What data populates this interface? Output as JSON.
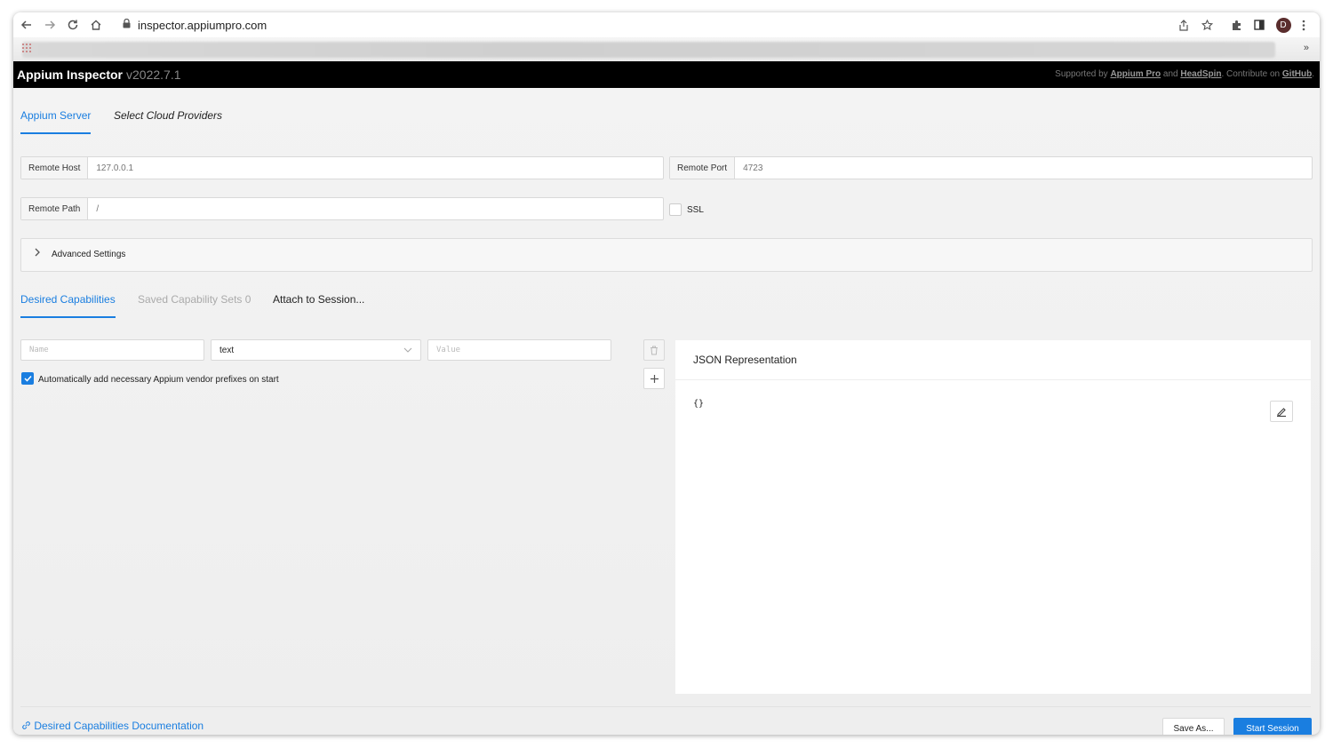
{
  "browser": {
    "url": "inspector.appiumpro.com",
    "profile_initial": "D",
    "bookmarks_more": "»"
  },
  "header": {
    "title": "Appium Inspector",
    "version": "v2022.7.1",
    "support_prefix": "Supported by",
    "link_appium_pro": "Appium Pro",
    "and": "and",
    "link_headspin": "HeadSpin",
    "contribute": ". Contribute on",
    "link_github": "GitHub",
    "period": "."
  },
  "server_tabs": [
    {
      "label": "Appium Server",
      "active": true
    },
    {
      "label": "Select Cloud Providers",
      "active": false
    }
  ],
  "server": {
    "remote_host_label": "Remote Host",
    "remote_host_placeholder": "127.0.0.1",
    "remote_port_label": "Remote Port",
    "remote_port_placeholder": "4723",
    "remote_path_label": "Remote Path",
    "remote_path_placeholder": "/",
    "ssl_label": "SSL",
    "ssl_checked": false
  },
  "advanced": {
    "label": "Advanced Settings",
    "arrow": ">"
  },
  "cap_tabs": [
    {
      "label": "Desired Capabilities",
      "active": true
    },
    {
      "label": "Saved Capability Sets 0",
      "active": false
    },
    {
      "label": "Attach to Session...",
      "active": false
    }
  ],
  "capability_row": {
    "name_placeholder": "Name",
    "type_value": "text",
    "value_placeholder": "Value"
  },
  "auto_prefix": {
    "label": "Automatically add necessary Appium vendor prefixes on start",
    "checked": true
  },
  "json_panel": {
    "title": "JSON Representation",
    "content": "{}"
  },
  "footer": {
    "doc_link": "Desired Capabilities Documentation",
    "save_as": "Save As...",
    "start_session": "Start Session"
  },
  "colors": {
    "accent": "#1a7ee0",
    "header_bg": "#000000"
  }
}
